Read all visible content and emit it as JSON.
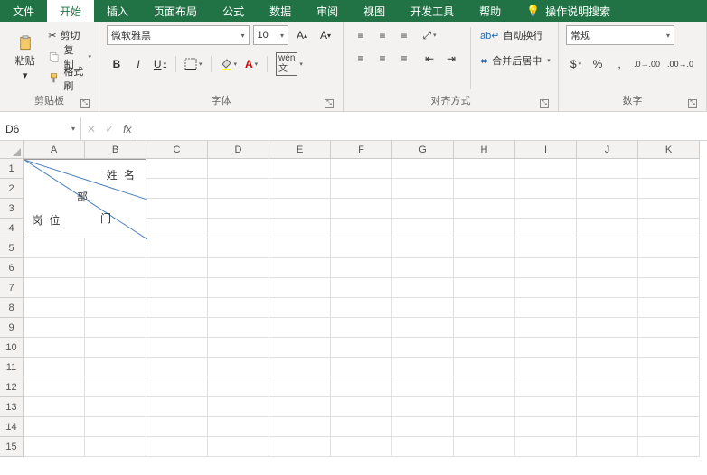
{
  "menu": {
    "file": "文件",
    "home": "开始",
    "insert": "插入",
    "layout": "页面布局",
    "formula": "公式",
    "data": "数据",
    "review": "审阅",
    "view": "视图",
    "dev": "开发工具",
    "help": "帮助",
    "tell": "操作说明搜索"
  },
  "clipboard": {
    "paste": "粘贴",
    "cut": "剪切",
    "copy": "复制",
    "painter": "格式刷",
    "label": "剪贴板"
  },
  "font": {
    "name": "微软雅黑",
    "size": "10",
    "bold": "B",
    "italic": "I",
    "underline": "U",
    "label": "字体",
    "wen": "wén",
    "wen2": "文"
  },
  "align": {
    "wrap": "自动换行",
    "merge": "合并后居中",
    "label": "对齐方式"
  },
  "number": {
    "format": "常规",
    "label": "数字"
  },
  "namebox": "D6",
  "cellcontent": {
    "name": "姓 名",
    "dept": "部",
    "dept2": "门",
    "post": "岗 位"
  },
  "cols": [
    "A",
    "B",
    "C",
    "D",
    "E",
    "F",
    "G",
    "H",
    "I",
    "J",
    "K"
  ],
  "rows": [
    "1",
    "2",
    "3",
    "4",
    "5",
    "6",
    "7",
    "8",
    "9",
    "10",
    "11",
    "12",
    "13",
    "14",
    "15"
  ]
}
